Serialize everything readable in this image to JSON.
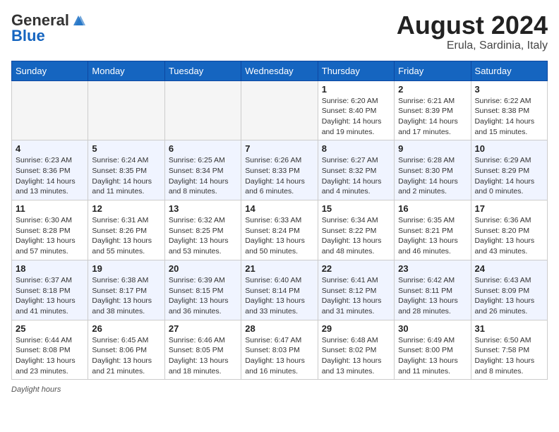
{
  "logo": {
    "line1": "General",
    "line2": "Blue"
  },
  "title": "August 2024",
  "location": "Erula, Sardinia, Italy",
  "days_of_week": [
    "Sunday",
    "Monday",
    "Tuesday",
    "Wednesday",
    "Thursday",
    "Friday",
    "Saturday"
  ],
  "footer": {
    "label": "Daylight hours"
  },
  "weeks": [
    [
      {
        "day": "",
        "info": ""
      },
      {
        "day": "",
        "info": ""
      },
      {
        "day": "",
        "info": ""
      },
      {
        "day": "",
        "info": ""
      },
      {
        "day": "1",
        "info": "Sunrise: 6:20 AM\nSunset: 8:40 PM\nDaylight: 14 hours\nand 19 minutes."
      },
      {
        "day": "2",
        "info": "Sunrise: 6:21 AM\nSunset: 8:39 PM\nDaylight: 14 hours\nand 17 minutes."
      },
      {
        "day": "3",
        "info": "Sunrise: 6:22 AM\nSunset: 8:38 PM\nDaylight: 14 hours\nand 15 minutes."
      }
    ],
    [
      {
        "day": "4",
        "info": "Sunrise: 6:23 AM\nSunset: 8:36 PM\nDaylight: 14 hours\nand 13 minutes."
      },
      {
        "day": "5",
        "info": "Sunrise: 6:24 AM\nSunset: 8:35 PM\nDaylight: 14 hours\nand 11 minutes."
      },
      {
        "day": "6",
        "info": "Sunrise: 6:25 AM\nSunset: 8:34 PM\nDaylight: 14 hours\nand 8 minutes."
      },
      {
        "day": "7",
        "info": "Sunrise: 6:26 AM\nSunset: 8:33 PM\nDaylight: 14 hours\nand 6 minutes."
      },
      {
        "day": "8",
        "info": "Sunrise: 6:27 AM\nSunset: 8:32 PM\nDaylight: 14 hours\nand 4 minutes."
      },
      {
        "day": "9",
        "info": "Sunrise: 6:28 AM\nSunset: 8:30 PM\nDaylight: 14 hours\nand 2 minutes."
      },
      {
        "day": "10",
        "info": "Sunrise: 6:29 AM\nSunset: 8:29 PM\nDaylight: 14 hours\nand 0 minutes."
      }
    ],
    [
      {
        "day": "11",
        "info": "Sunrise: 6:30 AM\nSunset: 8:28 PM\nDaylight: 13 hours\nand 57 minutes."
      },
      {
        "day": "12",
        "info": "Sunrise: 6:31 AM\nSunset: 8:26 PM\nDaylight: 13 hours\nand 55 minutes."
      },
      {
        "day": "13",
        "info": "Sunrise: 6:32 AM\nSunset: 8:25 PM\nDaylight: 13 hours\nand 53 minutes."
      },
      {
        "day": "14",
        "info": "Sunrise: 6:33 AM\nSunset: 8:24 PM\nDaylight: 13 hours\nand 50 minutes."
      },
      {
        "day": "15",
        "info": "Sunrise: 6:34 AM\nSunset: 8:22 PM\nDaylight: 13 hours\nand 48 minutes."
      },
      {
        "day": "16",
        "info": "Sunrise: 6:35 AM\nSunset: 8:21 PM\nDaylight: 13 hours\nand 46 minutes."
      },
      {
        "day": "17",
        "info": "Sunrise: 6:36 AM\nSunset: 8:20 PM\nDaylight: 13 hours\nand 43 minutes."
      }
    ],
    [
      {
        "day": "18",
        "info": "Sunrise: 6:37 AM\nSunset: 8:18 PM\nDaylight: 13 hours\nand 41 minutes."
      },
      {
        "day": "19",
        "info": "Sunrise: 6:38 AM\nSunset: 8:17 PM\nDaylight: 13 hours\nand 38 minutes."
      },
      {
        "day": "20",
        "info": "Sunrise: 6:39 AM\nSunset: 8:15 PM\nDaylight: 13 hours\nand 36 minutes."
      },
      {
        "day": "21",
        "info": "Sunrise: 6:40 AM\nSunset: 8:14 PM\nDaylight: 13 hours\nand 33 minutes."
      },
      {
        "day": "22",
        "info": "Sunrise: 6:41 AM\nSunset: 8:12 PM\nDaylight: 13 hours\nand 31 minutes."
      },
      {
        "day": "23",
        "info": "Sunrise: 6:42 AM\nSunset: 8:11 PM\nDaylight: 13 hours\nand 28 minutes."
      },
      {
        "day": "24",
        "info": "Sunrise: 6:43 AM\nSunset: 8:09 PM\nDaylight: 13 hours\nand 26 minutes."
      }
    ],
    [
      {
        "day": "25",
        "info": "Sunrise: 6:44 AM\nSunset: 8:08 PM\nDaylight: 13 hours\nand 23 minutes."
      },
      {
        "day": "26",
        "info": "Sunrise: 6:45 AM\nSunset: 8:06 PM\nDaylight: 13 hours\nand 21 minutes."
      },
      {
        "day": "27",
        "info": "Sunrise: 6:46 AM\nSunset: 8:05 PM\nDaylight: 13 hours\nand 18 minutes."
      },
      {
        "day": "28",
        "info": "Sunrise: 6:47 AM\nSunset: 8:03 PM\nDaylight: 13 hours\nand 16 minutes."
      },
      {
        "day": "29",
        "info": "Sunrise: 6:48 AM\nSunset: 8:02 PM\nDaylight: 13 hours\nand 13 minutes."
      },
      {
        "day": "30",
        "info": "Sunrise: 6:49 AM\nSunset: 8:00 PM\nDaylight: 13 hours\nand 11 minutes."
      },
      {
        "day": "31",
        "info": "Sunrise: 6:50 AM\nSunset: 7:58 PM\nDaylight: 13 hours\nand 8 minutes."
      }
    ]
  ]
}
